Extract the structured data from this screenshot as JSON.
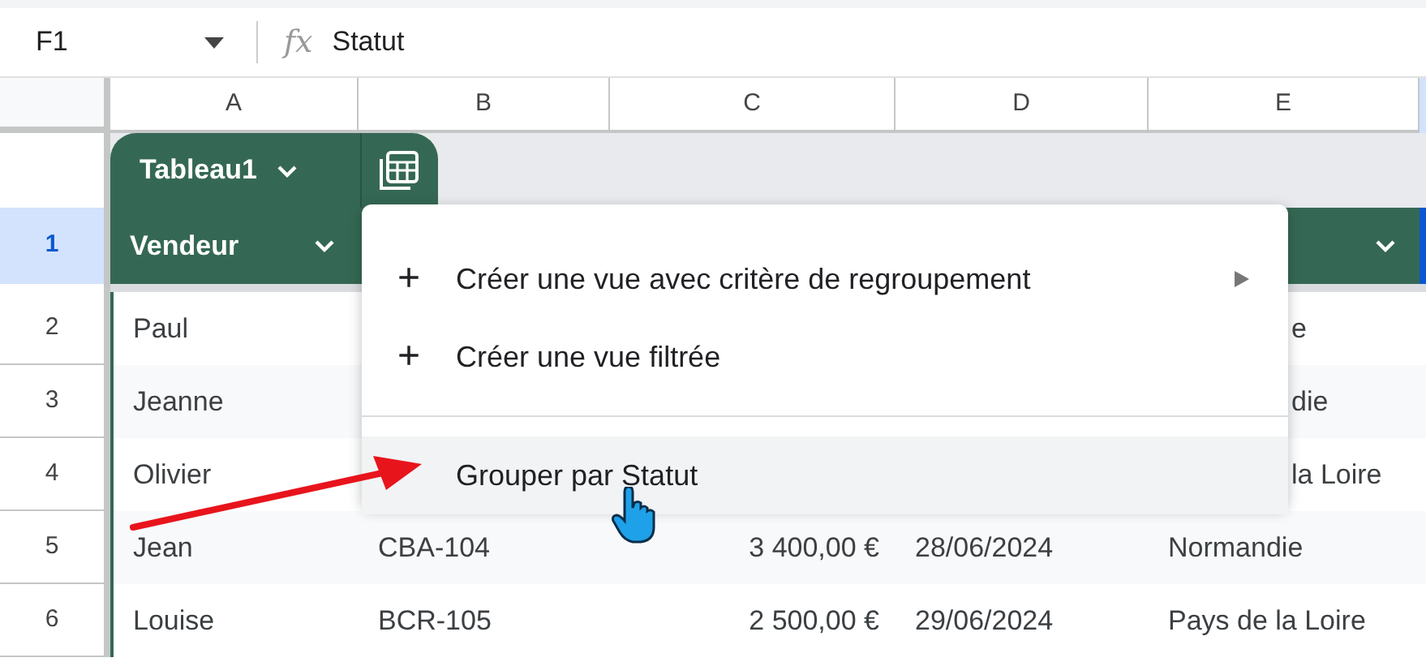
{
  "name_box": "F1",
  "formula_label": "fx",
  "formula": "Statut",
  "columns": [
    {
      "label": "A"
    },
    {
      "label": "B"
    },
    {
      "label": "C"
    },
    {
      "label": "D"
    },
    {
      "label": "E"
    }
  ],
  "table": {
    "name": "Tableau1",
    "header_row": {
      "number": "1",
      "selected": true,
      "label": "Vendeur"
    },
    "rows": [
      {
        "number": "2",
        "selected": false,
        "cells": {
          "A": "Paul",
          "E": "e"
        }
      },
      {
        "number": "3",
        "selected": false,
        "cells": {
          "A": "Jeanne",
          "E": "die"
        }
      },
      {
        "number": "4",
        "selected": false,
        "cells": {
          "A": "Olivier",
          "E": "la Loire"
        }
      },
      {
        "number": "5",
        "selected": false,
        "cells": {
          "A": "Jean",
          "B": "CBA-104",
          "C": "3 400,00 €",
          "D": "28/06/2024",
          "E": "Normandie"
        }
      },
      {
        "number": "6",
        "selected": false,
        "cells": {
          "A": "Louise",
          "B": "BCR-105",
          "C": "2 500,00 €",
          "D": "29/06/2024",
          "E": "Pays de la Loire"
        }
      }
    ]
  },
  "menu": {
    "items": [
      {
        "kind": "action",
        "icon": "+",
        "label": "Créer une vue avec critère de regroupement",
        "submenu": true,
        "selected": false
      },
      {
        "kind": "action",
        "icon": "+",
        "label": "Créer une vue filtrée",
        "submenu": false,
        "selected": false
      },
      {
        "kind": "divider"
      },
      {
        "kind": "action",
        "label": "Grouper par Statut",
        "submenu": false,
        "selected": true
      }
    ]
  }
}
